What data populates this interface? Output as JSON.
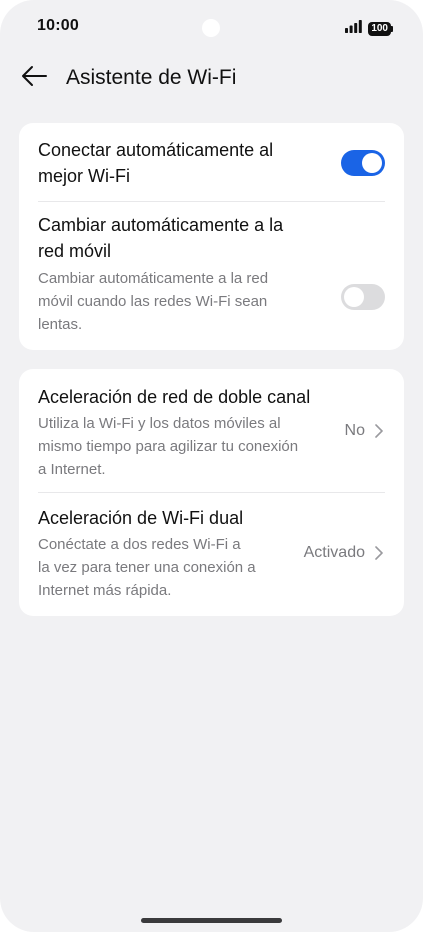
{
  "status_bar": {
    "time": "10:00",
    "battery": "100",
    "icons": [
      "signal-icon",
      "battery-icon"
    ]
  },
  "header": {
    "back_icon": "back-arrow-icon",
    "title": "Asistente de Wi-Fi"
  },
  "colors": {
    "background": "#f1f1f3",
    "card": "#ffffff",
    "accent": "#1a64e6",
    "toggle_off": "#dcdcde",
    "secondary_text": "#7a7a7e"
  },
  "card1": {
    "auto_best": {
      "title_line1": "Conectar automáticamente al",
      "title_line2": "mejor Wi-Fi",
      "enabled": true
    },
    "auto_mobile": {
      "title_line1": "Cambiar automáticamente a la",
      "title_line2": "red móvil",
      "desc_line1": "Cambiar automáticamente a la red",
      "desc_line2": "móvil cuando las redes Wi-Fi sean",
      "desc_line3": "lentas.",
      "enabled": false
    }
  },
  "card2": {
    "dual_channel": {
      "title": "Aceleración de red de doble canal",
      "desc_line1": "Utiliza la Wi-Fi y los datos móviles al",
      "desc_line2": "mismo tiempo para agilizar tu conexión",
      "desc_line3": "a Internet.",
      "value": "No"
    },
    "dual_wifi": {
      "title": "Aceleración de Wi-Fi dual",
      "desc_line1": "Conéctate a dos redes Wi-Fi a",
      "desc_line2": "la vez para tener una conexión a",
      "desc_line3": "Internet más rápida.",
      "value": "Activado"
    }
  }
}
